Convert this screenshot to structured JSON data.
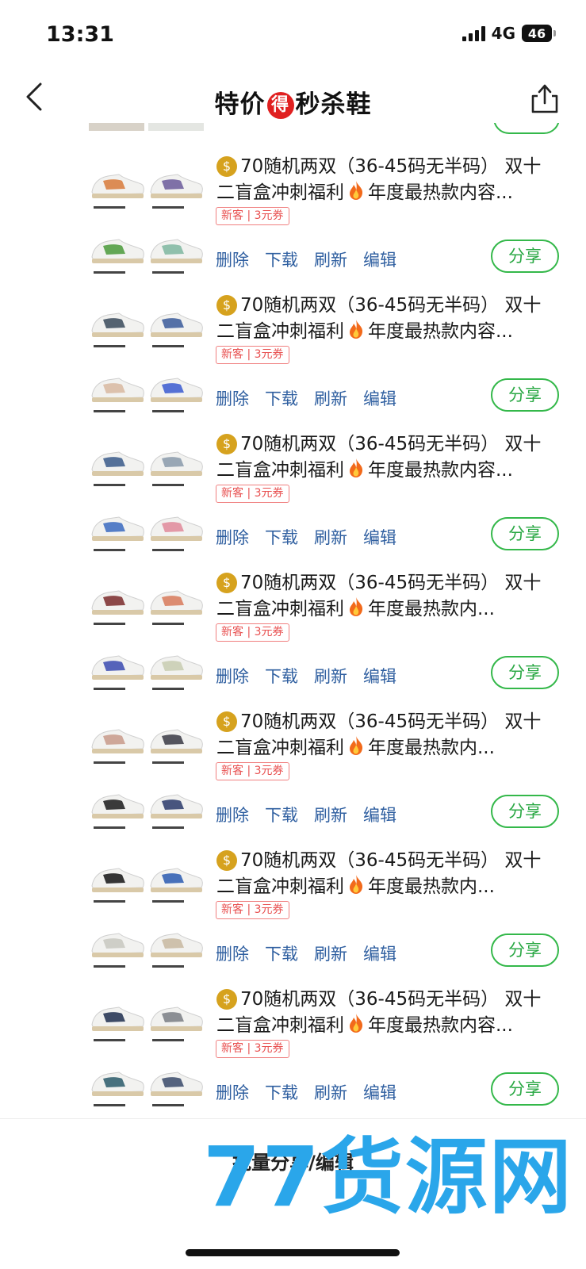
{
  "status": {
    "time": "13:31",
    "network": "4G",
    "battery": "46"
  },
  "nav": {
    "title_left": "特价",
    "title_badge": "得",
    "title_right": "秒杀鞋"
  },
  "colors": {
    "accent_green": "#34b84a",
    "action_blue": "#2f5fa0",
    "coupon_red": "#e85050",
    "watermark_blue": "#2aa6ea"
  },
  "items": [
    {
      "title_a": "70随机两双（36-45码无半码） 双十二盲盒冲刺福利",
      "title_b": "年度最热款内容...",
      "coupon": "新客 | 3元券",
      "actions": [
        "删除",
        "下载",
        "刷新",
        "编辑"
      ],
      "share": "分享",
      "shoe_colors": [
        "#d87a3a",
        "#6b5a9a",
        "#4a9a3a",
        "#7fb7a0"
      ]
    },
    {
      "title_a": "70随机两双（36-45码无半码） 双十二盲盒冲刺福利",
      "title_b": "年度最热款内容...",
      "coupon": "新客 | 3元券",
      "actions": [
        "删除",
        "下载",
        "刷新",
        "编辑"
      ],
      "share": "分享",
      "shoe_colors": [
        "#3a4a5a",
        "#3a5a9a",
        "#d8b8a0",
        "#3a5ad0"
      ]
    },
    {
      "title_a": "70随机两双（36-45码无半码） 双十二盲盒冲刺福利",
      "title_b": "年度最热款内容...",
      "coupon": "新客 | 3元券",
      "actions": [
        "删除",
        "下载",
        "刷新",
        "编辑"
      ],
      "share": "分享",
      "shoe_colors": [
        "#3a5a8a",
        "#8a9aaa",
        "#3a6ac0",
        "#e08a9a"
      ]
    },
    {
      "title_a": "70随机两双（36-45码无半码） 双十二盲盒冲刺福利",
      "title_b": "年度最热款内...",
      "coupon": "新客 | 3元券",
      "actions": [
        "删除",
        "下载",
        "刷新",
        "编辑"
      ],
      "share": "分享",
      "shoe_colors": [
        "#7a2a2a",
        "#d87a5a",
        "#3a4ab0",
        "#c8ccb0"
      ]
    },
    {
      "title_a": "70随机两双（36-45码无半码） 双十二盲盒冲刺福利",
      "title_b": "年度最热款内...",
      "coupon": "新客 | 3元券",
      "actions": [
        "删除",
        "下载",
        "刷新",
        "编辑"
      ],
      "share": "分享",
      "shoe_colors": [
        "#c89a8a",
        "#3a3a44",
        "#1a1a1a",
        "#2a3a6a"
      ]
    },
    {
      "title_a": "70随机两双（36-45码无半码） 双十二盲盒冲刺福利",
      "title_b": "年度最热款内...",
      "coupon": "新客 | 3元券",
      "actions": [
        "删除",
        "下载",
        "刷新",
        "编辑"
      ],
      "share": "分享",
      "shoe_colors": [
        "#141414",
        "#2a5ab0",
        "#c8c8c0",
        "#c8b8a0"
      ]
    },
    {
      "title_a": "70随机两双（36-45码无半码） 双十二盲盒冲刺福利",
      "title_b": "年度最热款内容...",
      "coupon": "新客 | 3元券",
      "actions": [
        "删除",
        "下载",
        "刷新",
        "编辑"
      ],
      "share": "分享",
      "shoe_colors": [
        "#1e2e4e",
        "#7a7e84",
        "#2a5a6a",
        "#3a4a6a"
      ]
    }
  ],
  "bottom": {
    "batch_label": "批量分享/编辑",
    "watermark": "77货源网"
  }
}
